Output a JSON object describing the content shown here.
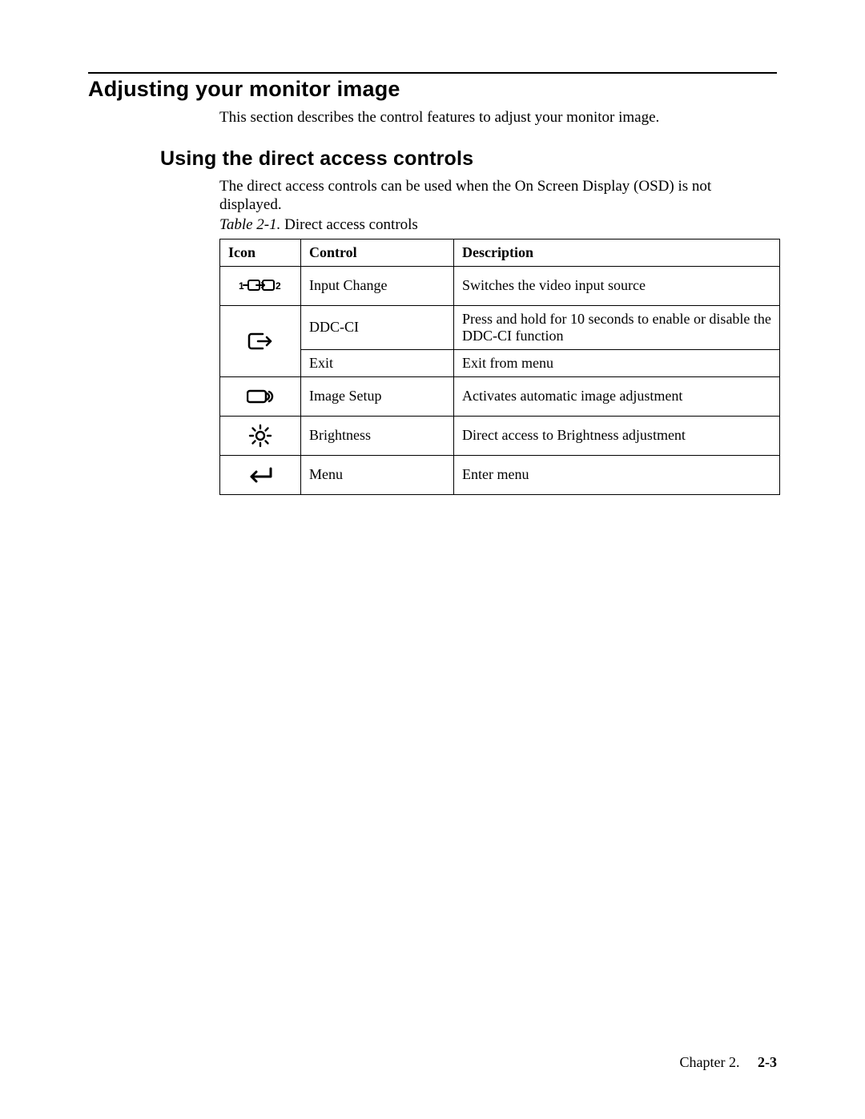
{
  "heading": "Adjusting your monitor image",
  "intro": "This section describes the control features to adjust your monitor image.",
  "subheading": "Using the direct access controls",
  "subintro": "The direct access controls can be used when the On Screen Display (OSD) is not displayed.",
  "table": {
    "caption_label": "Table 2-1.",
    "caption_text": "Direct access controls",
    "headers": {
      "icon": "Icon",
      "control": "Control",
      "description": "Description"
    },
    "rows": [
      {
        "icon": "input-change-icon",
        "control": "Input Change",
        "description": "Switches the video input source"
      },
      {
        "icon": "exit-icon",
        "control": "DDC-CI",
        "description": "Press and hold for 10 seconds to enable or disable the DDC-CI function"
      },
      {
        "icon": "",
        "control": "Exit",
        "description": "Exit from menu"
      },
      {
        "icon": "image-setup-icon",
        "control": "Image Setup",
        "description": "Activates automatic image adjustment"
      },
      {
        "icon": "brightness-icon",
        "control": "Brightness",
        "description": "Direct access to Brightness adjustment"
      },
      {
        "icon": "menu-icon",
        "control": "Menu",
        "description": "Enter menu"
      }
    ]
  },
  "footer": {
    "chapter": "Chapter 2.",
    "page": "2-3"
  }
}
